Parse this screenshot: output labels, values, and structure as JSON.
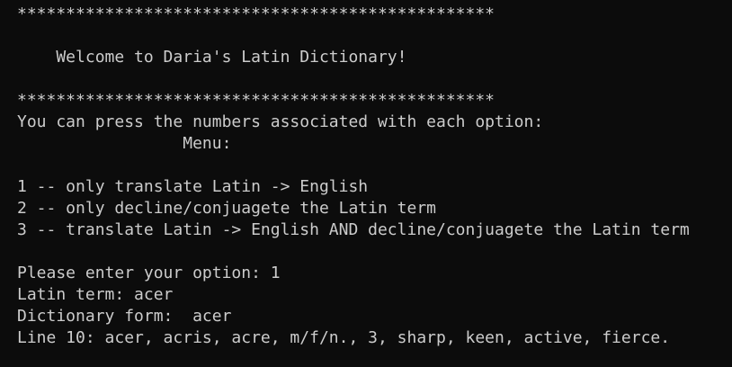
{
  "terminal": {
    "lines": [
      "*************************************************",
      "",
      "    Welcome to Daria's Latin Dictionary!",
      "",
      "*************************************************",
      "You can press the numbers associated with each option:",
      "                 Menu:",
      "",
      "1 -- only translate Latin -> English",
      "2 -- only decline/conjuagete the Latin term",
      "3 -- translate Latin -> English AND decline/conjuagete the Latin term",
      "",
      "Please enter your option: 1",
      "Latin term: acer",
      "Dictionary form:  acer",
      "Line 10: acer, acris, acre, m/f/n., 3, sharp, keen, active, fierce."
    ]
  }
}
